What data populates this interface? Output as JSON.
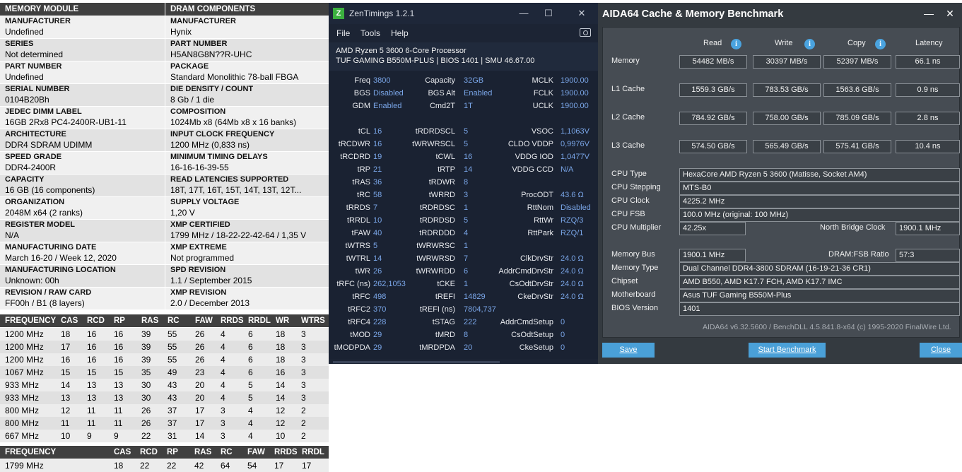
{
  "spd": {
    "header_left": "MEMORY MODULE",
    "header_right": "DRAM COMPONENTS",
    "rows": [
      {
        "l_label": "MANUFACTURER",
        "l_value": "Undefined",
        "r_label": "MANUFACTURER",
        "r_value": "Hynix"
      },
      {
        "l_label": "SERIES",
        "l_value": "Not determined",
        "r_label": "PART NUMBER",
        "r_value": "H5AN8G8N??R-UHC"
      },
      {
        "l_label": "PART NUMBER",
        "l_value": "Undefined",
        "r_label": "PACKAGE",
        "r_value": "Standard Monolithic 78-ball FBGA"
      },
      {
        "l_label": "SERIAL NUMBER",
        "l_value": "0104B20Bh",
        "r_label": "DIE DENSITY / COUNT",
        "r_value": "8 Gb / 1 die"
      },
      {
        "l_label": "JEDEC DIMM LABEL",
        "l_value": "16GB 2Rx8 PC4-2400R-UB1-11",
        "r_label": "COMPOSITION",
        "r_value": "1024Mb x8 (64Mb x8 x 16 banks)"
      },
      {
        "l_label": "ARCHITECTURE",
        "l_value": "DDR4 SDRAM UDIMM",
        "r_label": "INPUT CLOCK FREQUENCY",
        "r_value": "1200 MHz (0,833 ns)"
      },
      {
        "l_label": "SPEED GRADE",
        "l_value": "DDR4-2400R",
        "r_label": "MINIMUM TIMING DELAYS",
        "r_value": "16-16-16-39-55"
      },
      {
        "l_label": "CAPACITY",
        "l_value": "16 GB (16 components)",
        "r_label": "READ LATENCIES SUPPORTED",
        "r_value": "18T, 17T, 16T, 15T, 14T, 13T, 12T..."
      },
      {
        "l_label": "ORGANIZATION",
        "l_value": "2048M x64 (2 ranks)",
        "r_label": "SUPPLY VOLTAGE",
        "r_value": "1,20 V"
      },
      {
        "l_label": "REGISTER MODEL",
        "l_value": "N/A",
        "r_label": "XMP CERTIFIED",
        "r_value": "1799 MHz / 18-22-22-42-64 / 1,35 V"
      },
      {
        "l_label": "MANUFACTURING DATE",
        "l_value": "March 16-20 / Week 12, 2020",
        "r_label": "XMP EXTREME",
        "r_value": "Not programmed"
      },
      {
        "l_label": "MANUFACTURING LOCATION",
        "l_value": "Unknown: 00h",
        "r_label": "SPD REVISION",
        "r_value": "1.1 / September 2015"
      },
      {
        "l_label": "REVISION / RAW CARD",
        "l_value": "FF00h / B1 (8 layers)",
        "r_label": "XMP REVISION",
        "r_value": "2.0 / December 2013"
      }
    ],
    "jedec_headers": [
      "FREQUENCY",
      "CAS",
      "RCD",
      "RP",
      "RAS",
      "RC",
      "FAW",
      "RRDS",
      "RRDL",
      "WR",
      "WTRS"
    ],
    "jedec_rows": [
      [
        "1200 MHz",
        "18",
        "16",
        "16",
        "39",
        "55",
        "26",
        "4",
        "6",
        "18",
        "3"
      ],
      [
        "1200 MHz",
        "17",
        "16",
        "16",
        "39",
        "55",
        "26",
        "4",
        "6",
        "18",
        "3"
      ],
      [
        "1200 MHz",
        "16",
        "16",
        "16",
        "39",
        "55",
        "26",
        "4",
        "6",
        "18",
        "3"
      ],
      [
        "1067 MHz",
        "15",
        "15",
        "15",
        "35",
        "49",
        "23",
        "4",
        "6",
        "16",
        "3"
      ],
      [
        "933 MHz",
        "14",
        "13",
        "13",
        "30",
        "43",
        "20",
        "4",
        "5",
        "14",
        "3"
      ],
      [
        "933 MHz",
        "13",
        "13",
        "13",
        "30",
        "43",
        "20",
        "4",
        "5",
        "14",
        "3"
      ],
      [
        "800 MHz",
        "12",
        "11",
        "11",
        "26",
        "37",
        "17",
        "3",
        "4",
        "12",
        "2"
      ],
      [
        "800 MHz",
        "11",
        "11",
        "11",
        "26",
        "37",
        "17",
        "3",
        "4",
        "12",
        "2"
      ],
      [
        "667 MHz",
        "10",
        "9",
        "9",
        "22",
        "31",
        "14",
        "3",
        "4",
        "10",
        "2"
      ]
    ],
    "xmp_headers": [
      "FREQUENCY",
      "CAS",
      "RCD",
      "RP",
      "RAS",
      "RC",
      "FAW",
      "RRDS",
      "RRDL"
    ],
    "xmp_rows": [
      [
        "1799 MHz",
        "18",
        "22",
        "22",
        "42",
        "64",
        "54",
        "17",
        "17"
      ]
    ]
  },
  "zen": {
    "logo": "Z",
    "title": "ZenTimings 1.2.1",
    "min": "—",
    "max": "☐",
    "close": "✕",
    "menu": [
      "File",
      "Tools",
      "Help"
    ],
    "cpu": "AMD Ryzen 5 3600 6-Core Processor",
    "board": "TUF GAMING B550M-PLUS | BIOS 1401 | SMU 46.67.00",
    "rows": [
      [
        "Freq",
        "3800",
        "Capacity",
        "32GB",
        "MCLK",
        "1900.00"
      ],
      [
        "BGS",
        "Disabled",
        "BGS Alt",
        "Enabled",
        "FCLK",
        "1900.00"
      ],
      [
        "GDM",
        "Enabled",
        "Cmd2T",
        "1T",
        "UCLK",
        "1900.00"
      ],
      [
        "",
        "",
        "",
        "",
        "",
        ""
      ],
      [
        "tCL",
        "16",
        "tRDRDSCL",
        "5",
        "VSOC",
        "1,1063V"
      ],
      [
        "tRCDWR",
        "16",
        "tWRWRSCL",
        "5",
        "CLDO VDDP",
        "0,9976V"
      ],
      [
        "tRCDRD",
        "19",
        "tCWL",
        "16",
        "VDDG IOD",
        "1,0477V"
      ],
      [
        "tRP",
        "21",
        "tRTP",
        "14",
        "VDDG CCD",
        "N/A"
      ],
      [
        "tRAS",
        "36",
        "tRDWR",
        "8",
        "",
        ""
      ],
      [
        "tRC",
        "58",
        "tWRRD",
        "3",
        "ProcODT",
        "43.6 Ω"
      ],
      [
        "tRRDS",
        "7",
        "tRDRDSC",
        "1",
        "RttNom",
        "Disabled"
      ],
      [
        "tRRDL",
        "10",
        "tRDRDSD",
        "5",
        "RttWr",
        "RZQ/3"
      ],
      [
        "tFAW",
        "40",
        "tRDRDDD",
        "4",
        "RttPark",
        "RZQ/1"
      ],
      [
        "tWTRS",
        "5",
        "tWRWRSC",
        "1",
        "",
        ""
      ],
      [
        "tWTRL",
        "14",
        "tWRWRSD",
        "7",
        "ClkDrvStr",
        "24.0 Ω"
      ],
      [
        "tWR",
        "26",
        "tWRWRDD",
        "6",
        "AddrCmdDrvStr",
        "24.0 Ω"
      ],
      [
        "tRFC (ns)",
        "262,1053",
        "tCKE",
        "1",
        "CsOdtDrvStr",
        "24.0 Ω"
      ],
      [
        "tRFC",
        "498",
        "tREFI",
        "14829",
        "CkeDrvStr",
        "24.0 Ω"
      ],
      [
        "tRFC2",
        "370",
        "tREFI (ns)",
        "7804,737",
        "",
        ""
      ],
      [
        "tRFC4",
        "228",
        "tSTAG",
        "222",
        "AddrCmdSetup",
        "0"
      ],
      [
        "tMOD",
        "29",
        "tMRD",
        "8",
        "CsOdtSetup",
        "0"
      ],
      [
        "tMODPDA",
        "29",
        "tMRDPDA",
        "20",
        "CkeSetup",
        "0"
      ]
    ]
  },
  "aida": {
    "title": "AIDA64 Cache & Memory Benchmark",
    "minimize": "—",
    "close": "✕",
    "col_read": "Read",
    "col_write": "Write",
    "col_copy": "Copy",
    "col_latency": "Latency",
    "info_glyph": "i",
    "bench": [
      {
        "label": "Memory",
        "read": "54482 MB/s",
        "write": "30397 MB/s",
        "copy": "52397 MB/s",
        "latency": "66.1 ns"
      },
      {
        "label": "L1 Cache",
        "read": "1559.3 GB/s",
        "write": "783.53 GB/s",
        "copy": "1563.6 GB/s",
        "latency": "0.9 ns"
      },
      {
        "label": "L2 Cache",
        "read": "784.92 GB/s",
        "write": "758.00 GB/s",
        "copy": "785.09 GB/s",
        "latency": "2.8 ns"
      },
      {
        "label": "L3 Cache",
        "read": "574.50 GB/s",
        "write": "565.49 GB/s",
        "copy": "575.41 GB/s",
        "latency": "10.4 ns"
      }
    ],
    "cpu_type_label": "CPU Type",
    "cpu_type": "HexaCore AMD Ryzen 5 3600  (Matisse, Socket AM4)",
    "cpu_stepping_label": "CPU Stepping",
    "cpu_stepping": "MTS-B0",
    "cpu_clock_label": "CPU Clock",
    "cpu_clock": "4225.2 MHz",
    "cpu_fsb_label": "CPU FSB",
    "cpu_fsb": "100.0 MHz  (original: 100 MHz)",
    "cpu_mult_label": "CPU Multiplier",
    "cpu_mult": "42.25x",
    "nb_clock_label": "North Bridge Clock",
    "nb_clock": "1900.1 MHz",
    "mem_bus_label": "Memory Bus",
    "mem_bus": "1900.1 MHz",
    "dram_fsb_label": "DRAM:FSB Ratio",
    "dram_fsb": "57:3",
    "mem_type_label": "Memory Type",
    "mem_type": "Dual Channel DDR4-3800 SDRAM  (16-19-21-36 CR1)",
    "chipset_label": "Chipset",
    "chipset": "AMD B550, AMD K17.7 FCH, AMD K17.7 IMC",
    "mobo_label": "Motherboard",
    "mobo": "Asus TUF Gaming B550M-Plus",
    "bios_label": "BIOS Version",
    "bios": "1401",
    "footer": "AIDA64 v6.32.5600 / BenchDLL 4.5.841.8-x64  (c) 1995-2020 FinalWire Ltd.",
    "save": "Save",
    "start": "Start Benchmark",
    "close_btn": "Close",
    "colors": {
      "accent": "#4aa0d8",
      "background": "#343a40"
    }
  }
}
